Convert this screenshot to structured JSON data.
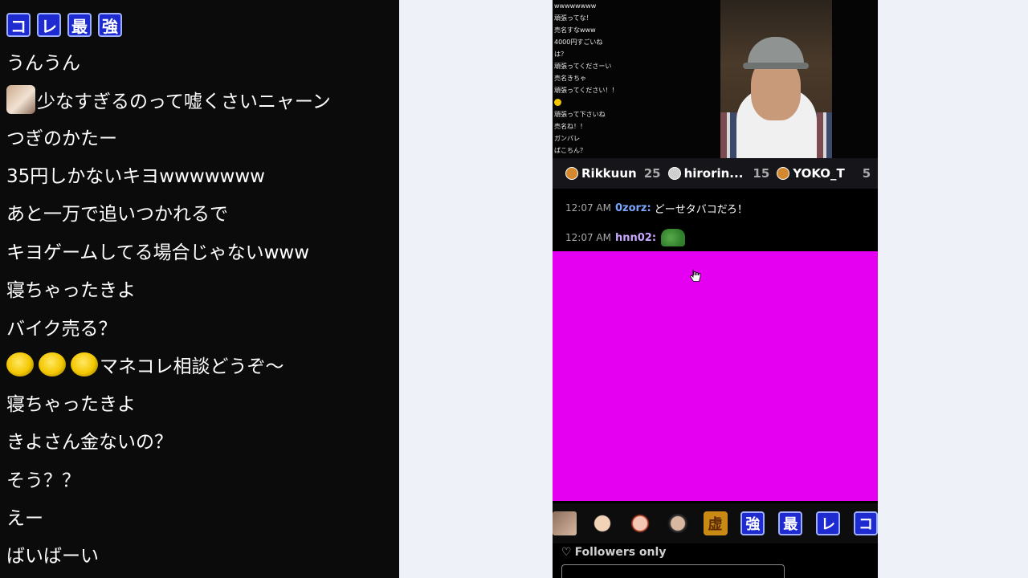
{
  "left_chat": {
    "header_emotes": [
      "コ",
      "レ",
      "最",
      "強"
    ],
    "lines": [
      {
        "text": "うんうん",
        "emotes": []
      },
      {
        "text": "少なすぎるのって嘘くさいニャーン",
        "emotes": [
          "cat-emote"
        ]
      },
      {
        "text": "つぎのかたー",
        "emotes": []
      },
      {
        "text": "35円しかないキヨwwwwwww",
        "emotes": []
      },
      {
        "text": "あと一万で追いつかれるで",
        "emotes": []
      },
      {
        "text": "キヨゲームしてる場合じゃないwww",
        "emotes": []
      },
      {
        "text": "寝ちゃったきよ",
        "emotes": []
      },
      {
        "text": "バイク売る？",
        "emotes": []
      },
      {
        "text": "マネコレ相談どうぞ～",
        "emotes": [
          "blob-emote",
          "blob-emote",
          "blob-emote"
        ]
      },
      {
        "text": "寝ちゃったきよ",
        "emotes": []
      },
      {
        "text": "きよさん金ないの？",
        "emotes": []
      },
      {
        "text": "そう？？",
        "emotes": []
      },
      {
        "text": "えー",
        "emotes": []
      },
      {
        "text": "ばいばーい",
        "emotes": []
      }
    ]
  },
  "stream": {
    "mini_chat": [
      "wwwwwwww",
      "頑張ってな！",
      "売名すなwww",
      "4000円すごいね",
      "は？",
      "頑張ってくださーい",
      "売名きちゃ",
      "頑張ってください！！",
      "",
      "頑張って下さいね",
      "売名ね！！",
      "ガンバレ",
      "ばこちん？"
    ],
    "leaderboard": [
      {
        "name": "Rikkuun",
        "count": "25"
      },
      {
        "name": "hirorin...",
        "count": "15"
      },
      {
        "name": "YOKO_T",
        "count": "5"
      }
    ],
    "chat": [
      {
        "time": "12:07 AM",
        "user": "0zorz:",
        "message": "どーせタバコだろ！"
      },
      {
        "time": "12:07 AM",
        "user": "hnn02:",
        "message": ""
      }
    ],
    "emote_bar": [
      {
        "type": "face",
        "label": ""
      },
      {
        "type": "face",
        "label": ""
      },
      {
        "type": "face",
        "label": ""
      },
      {
        "type": "face",
        "label": ""
      },
      {
        "type": "gold",
        "label": "虚"
      },
      {
        "type": "kanji",
        "label": "強"
      },
      {
        "type": "kanji",
        "label": "最"
      },
      {
        "type": "kanji",
        "label": "レ"
      },
      {
        "type": "kanji",
        "label": "コ"
      }
    ],
    "followers_label": "Followers only",
    "colors": {
      "magenta_panel": "#e600f2",
      "leaderboard_bg": "#15151a"
    }
  }
}
